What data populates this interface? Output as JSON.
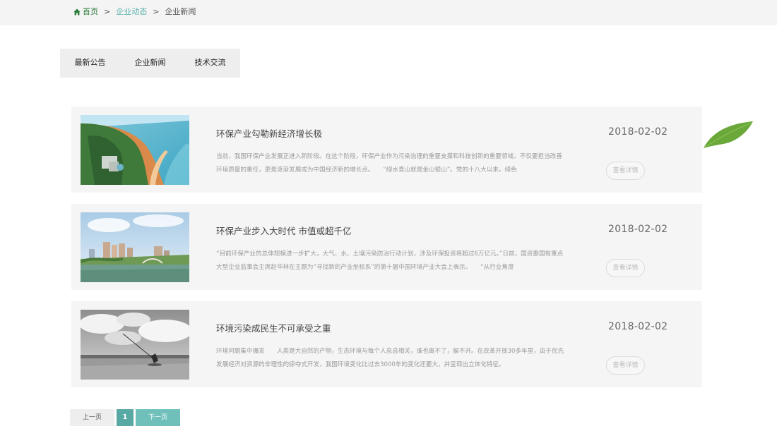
{
  "breadcrumb": {
    "home": "首页",
    "sep1": ">",
    "section": "企业动态",
    "sep2": ">",
    "current": "企业新闻"
  },
  "tabs": [
    {
      "label": "最新公告"
    },
    {
      "label": "企业新闻"
    },
    {
      "label": "技术交流"
    }
  ],
  "news": [
    {
      "title": "环保产业勾勒新经济增长极",
      "summary": "当前，我国环保产业发展正进入新阶段。在这个阶段，环保产业作为污染治理的重要支撑和科技创新的重要领域，不仅要担当改善环境质量的重任，更是逐渐发展成为中国经济新的增长点。　　“绿水青山就是金山银山”。党的十八大以来，绿色",
      "date": "2018-02-02",
      "button": "查看详情"
    },
    {
      "title": "环保产业步入大时代 市值或超千亿",
      "summary": "“目前环保产业的总体规模进一步扩大，大气、水、土壤污染防治行动计划，涉及环保投资将超过6万亿元。”日前，国资委国有重点大型企业监事会主席赵华林在主题为“寻找新的产业坐标系”的第十届中国环境产业大会上表示。　　“从行业角度",
      "date": "2018-02-02",
      "button": "查看详情"
    },
    {
      "title": "环境污染成民生不可承受之重",
      "summary": "环境问题集中爆发　　人类是大自然的产物，生态环境与每个人息息相关，谁也离不了，躲不开。在改革开放30多年里，由于优先发展经济对资源的非理性的掠夺式开发，我国环境变化比过去3000年的变化还要大，并呈现出立体化特征。",
      "date": "2018-02-02",
      "button": "查看详情"
    }
  ],
  "pager": {
    "prev": "上一页",
    "current": "1",
    "next": "下一页"
  },
  "colors": {
    "accent": "#58a8a3",
    "home_green": "#2e7d3c",
    "card_bg": "#f5f5f5"
  },
  "icons": {
    "home": "home-icon",
    "decor": "leaf-decoration"
  }
}
